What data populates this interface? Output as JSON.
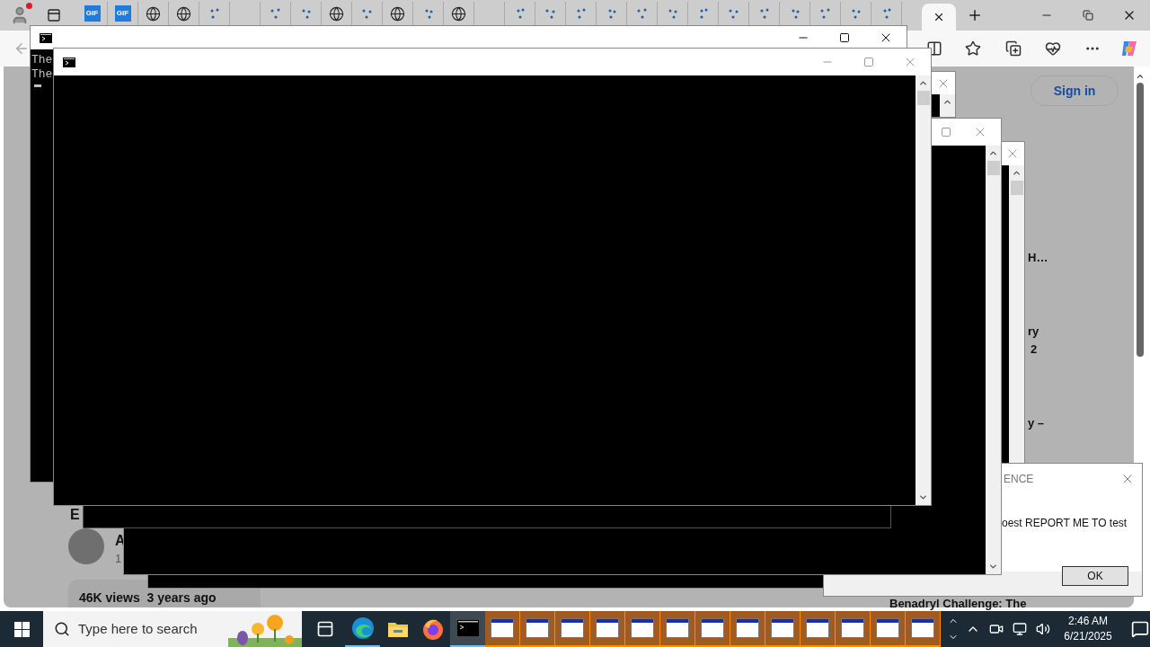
{
  "browser": {
    "tabs": [
      {
        "kind": "gif",
        "icon_text": "GIF",
        "selected": false
      },
      {
        "kind": "gif",
        "icon_text": "GIF",
        "selected": false
      },
      {
        "kind": "globe",
        "selected": false
      },
      {
        "kind": "globe",
        "selected": false
      },
      {
        "kind": "spinner",
        "selected": false
      },
      {
        "kind": "blank",
        "selected": false
      },
      {
        "kind": "spinner",
        "selected": false
      },
      {
        "kind": "spinner",
        "selected": false
      },
      {
        "kind": "globe",
        "selected": false
      },
      {
        "kind": "spinner",
        "selected": false
      },
      {
        "kind": "globe",
        "selected": false
      },
      {
        "kind": "spinner",
        "selected": false
      },
      {
        "kind": "globe",
        "selected": false
      },
      {
        "kind": "blank",
        "selected": false
      },
      {
        "kind": "spinner",
        "selected": false
      },
      {
        "kind": "spinner",
        "selected": false
      },
      {
        "kind": "spinner",
        "selected": false
      },
      {
        "kind": "spinner",
        "selected": false
      },
      {
        "kind": "spinner",
        "selected": false
      },
      {
        "kind": "spinner",
        "selected": false
      },
      {
        "kind": "spinner",
        "selected": false
      },
      {
        "kind": "spinner",
        "selected": false
      },
      {
        "kind": "spinner",
        "selected": false
      },
      {
        "kind": "spinner",
        "selected": false
      },
      {
        "kind": "spinner",
        "selected": false
      },
      {
        "kind": "spinner",
        "selected": false
      },
      {
        "kind": "spinner",
        "selected": false
      },
      {
        "kind": "current",
        "selected": true
      }
    ],
    "sign_in": "Sign in",
    "page": {
      "side_fragments": [
        "H…",
        "ry",
        "2",
        "y –"
      ],
      "video": {
        "title_fragment": "E",
        "channel_fragment": "A",
        "meta_fragment": "1",
        "stats": "46K views  3 years ago"
      },
      "next_title": "Benadryl Challenge: The"
    }
  },
  "consoles": [
    {
      "active": false
    },
    {
      "active": false
    },
    {
      "active": false
    },
    {
      "active": true,
      "lines": [
        "The",
        "The"
      ],
      "cursor": true
    },
    {
      "active": false
    }
  ],
  "dialog": {
    "title": "ENCE",
    "message": "oest REPORT ME TO test",
    "button": "OK"
  },
  "taskbar": {
    "search_placeholder": "Type here to search",
    "apps": [
      {
        "kind": "task-view",
        "running": false,
        "selected": false
      },
      {
        "kind": "edge",
        "running": true,
        "selected": false
      },
      {
        "kind": "explorer",
        "running": false,
        "selected": false
      },
      {
        "kind": "firefox",
        "running": false,
        "selected": false
      },
      {
        "kind": "console",
        "running": true,
        "selected": true
      },
      {
        "kind": "window",
        "running": true,
        "selected": false
      },
      {
        "kind": "window",
        "running": true,
        "selected": false
      },
      {
        "kind": "window",
        "running": true,
        "selected": false
      },
      {
        "kind": "window",
        "running": true,
        "selected": false
      },
      {
        "kind": "window",
        "running": true,
        "selected": false
      },
      {
        "kind": "window",
        "running": true,
        "selected": false
      },
      {
        "kind": "window",
        "running": true,
        "selected": false
      },
      {
        "kind": "window",
        "running": true,
        "selected": false
      },
      {
        "kind": "window",
        "running": true,
        "selected": false
      },
      {
        "kind": "window",
        "running": true,
        "selected": false
      },
      {
        "kind": "window",
        "running": true,
        "selected": false
      },
      {
        "kind": "window",
        "running": true,
        "selected": false
      },
      {
        "kind": "window",
        "running": true,
        "selected": false
      }
    ],
    "time": "2:46 AM",
    "date": "6/21/2025"
  }
}
